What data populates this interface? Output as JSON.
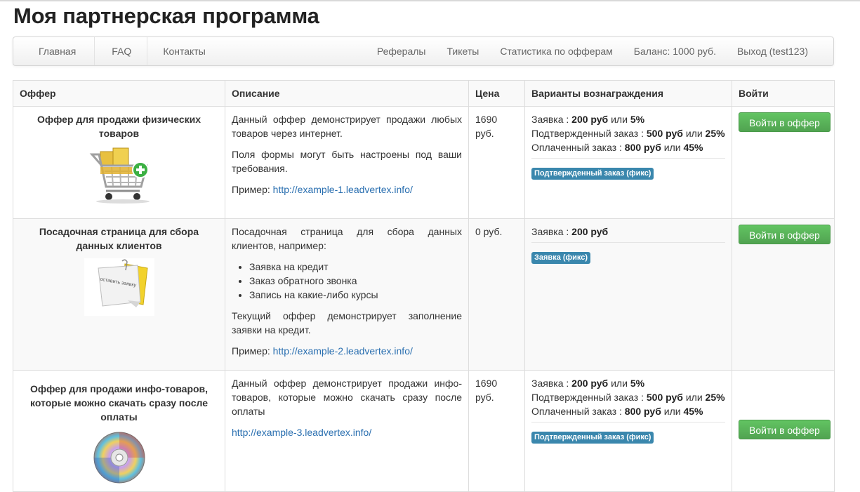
{
  "page": {
    "title": "Моя партнерская программа"
  },
  "nav": {
    "left": [
      "Главная",
      "FAQ",
      "Контакты"
    ],
    "right": [
      "Рефералы",
      "Тикеты",
      "Статистика по офферам",
      "Баланс: 1000 руб.",
      "Выход (test123)"
    ]
  },
  "table": {
    "headers": [
      "Оффер",
      "Описание",
      "Цена",
      "Варианты вознаграждения",
      "Войти"
    ],
    "rows": [
      {
        "offer_name": "Оффер для продажи физических товаров",
        "icon": "shopping-cart-icon",
        "desc1": "Данный оффер демонстрирует продажи любых товаров через интернет.",
        "desc2": "Поля формы могут быть настроены под ваши требования.",
        "example_label": "Пример:",
        "example_link": "http://example-1.leadvertex.info/",
        "price": "1690 руб.",
        "rewards": [
          {
            "label": "Заявка :",
            "rub": "200 руб",
            "sep": "или",
            "pct": "5%"
          },
          {
            "label": "Подтвержденный заказ :",
            "rub": "500 руб",
            "sep": "или",
            "pct": "25%"
          },
          {
            "label": "Оплаченный заказ :",
            "rub": "800 руб",
            "sep": "или",
            "pct": "45%"
          }
        ],
        "badge": "Подтвержденный заказ (фикс)",
        "button": "Войти в оффер"
      },
      {
        "offer_name": "Посадочная страница для сбора данных клиентов",
        "icon": "sticky-note-icon",
        "note_text": "оставить заявку",
        "desc1": "Посадочная страница для сбора данных клиентов, например:",
        "bullets": [
          "Заявка на кредит",
          "Заказ обратного звонка",
          "Запись на какие-либо курсы"
        ],
        "desc2": "Текущий оффер демонстрирует заполнение заявки на кредит.",
        "example_label": "Пример:",
        "example_link": "http://example-2.leadvertex.info/",
        "price": "0 руб.",
        "rewards": [
          {
            "label": "Заявка :",
            "rub": "200 руб"
          }
        ],
        "badge": "Заявка (фикс)",
        "button": "Войти в оффер"
      },
      {
        "offer_name": "Оффер для продажи инфо-товаров, которые можно скачать сразу после оплаты",
        "icon": "cd-disc-icon",
        "desc1": "Данный оффер демонстрирует продажи инфо-товаров, которые можно скачать сразу после оплаты",
        "example_link": "http://example-3.leadvertex.info/",
        "price": "1690 руб.",
        "rewards": [
          {
            "label": "Заявка :",
            "rub": "200 руб",
            "sep": "или",
            "pct": "5%"
          },
          {
            "label": "Подтвержденный заказ :",
            "rub": "500 руб",
            "sep": "или",
            "pct": "25%"
          },
          {
            "label": "Оплаченный заказ :",
            "rub": "800 руб",
            "sep": "или",
            "pct": "45%"
          }
        ],
        "badge": "Подтвержденный заказ (фикс)",
        "button": "Войти в оффер"
      }
    ]
  }
}
